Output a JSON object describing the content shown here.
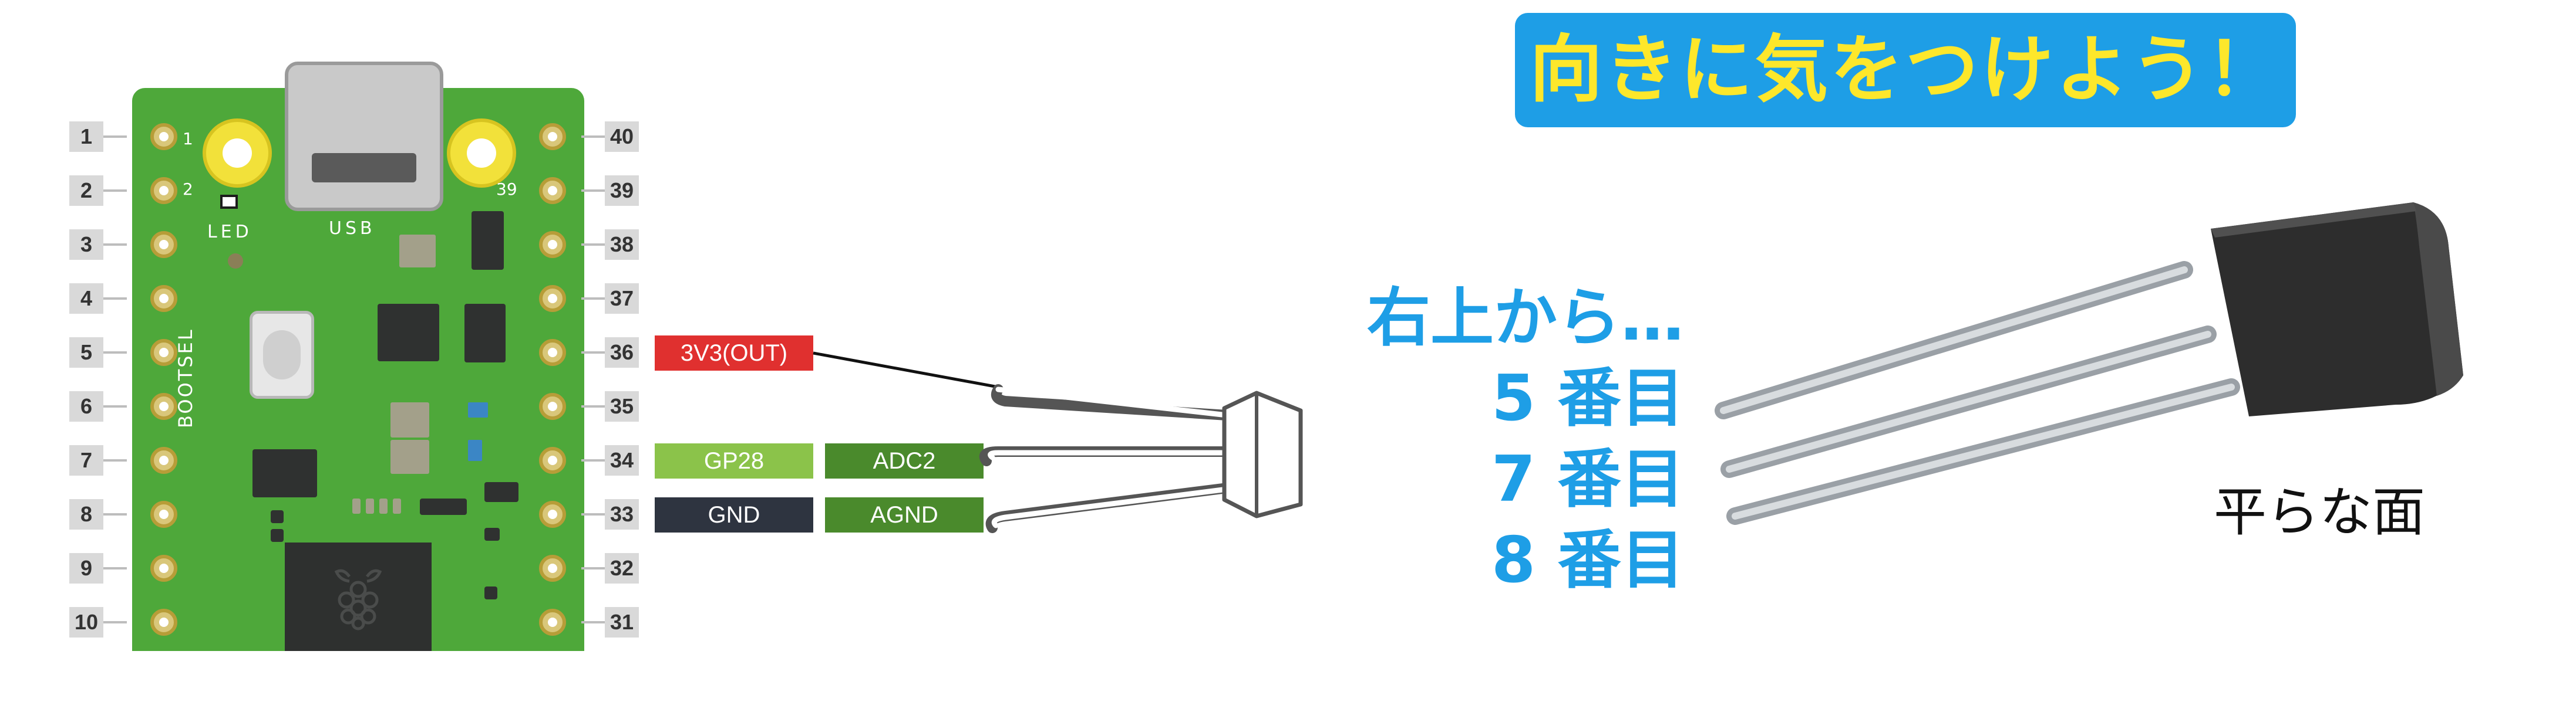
{
  "banner": {
    "text": "向きに気をつけよう！"
  },
  "instruction": {
    "from_top_right": "右上から…",
    "pins": [
      "5 番目",
      "7 番目",
      "8 番目"
    ]
  },
  "sensor": {
    "flat_face_label": "平らな面"
  },
  "board": {
    "led_label": "LED",
    "usb_label": "USB",
    "bootsel_label": "BOOTSEL",
    "small_pin_labels": {
      "p1": "1",
      "p2": "2",
      "p39": "39"
    },
    "left_pins": [
      "1",
      "2",
      "3",
      "4",
      "5",
      "6",
      "7",
      "8",
      "9",
      "10"
    ],
    "right_pins": [
      "40",
      "39",
      "38",
      "37",
      "36",
      "35",
      "34",
      "33",
      "32",
      "31"
    ],
    "pad_color": "#4ea83a"
  },
  "pin_tags": {
    "vout": {
      "label": "3V3(OUT)",
      "color": "#e0302f"
    },
    "gp28": {
      "label": "GP28",
      "color": "#8bc34a"
    },
    "adc2": {
      "label": "ADC2",
      "color": "#4a8a2c"
    },
    "gnd": {
      "label": "GND",
      "color": "#2e3440"
    },
    "agnd": {
      "label": "AGND",
      "color": "#4a8a2c"
    }
  },
  "colors": {
    "accent_blue": "#1e9ee6",
    "banner_text": "#fde72b"
  }
}
